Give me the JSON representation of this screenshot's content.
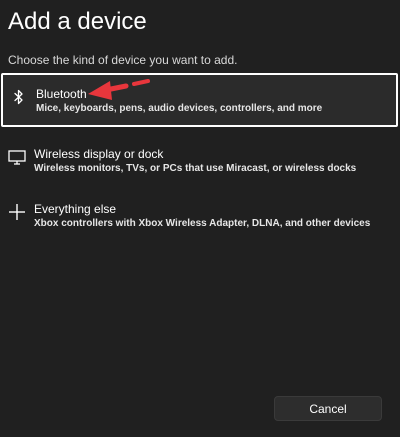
{
  "dialog": {
    "title": "Add a device",
    "subtitle": "Choose the kind of device you want to add."
  },
  "options": [
    {
      "name": "Bluetooth",
      "description": "Mice, keyboards, pens, audio devices, controllers, and more",
      "icon": "bluetooth-icon",
      "selected": true
    },
    {
      "name": "Wireless display or dock",
      "description": "Wireless monitors, TVs, or PCs that use Miracast, or wireless docks",
      "icon": "monitor-icon",
      "selected": false
    },
    {
      "name": "Everything else",
      "description": "Xbox controllers with Xbox Wireless Adapter, DLNA, and other devices",
      "icon": "plus-icon",
      "selected": false
    }
  ],
  "annotation": {
    "icon": "red-arrow-icon",
    "color": "#e8363c"
  },
  "footer": {
    "cancel_label": "Cancel"
  }
}
